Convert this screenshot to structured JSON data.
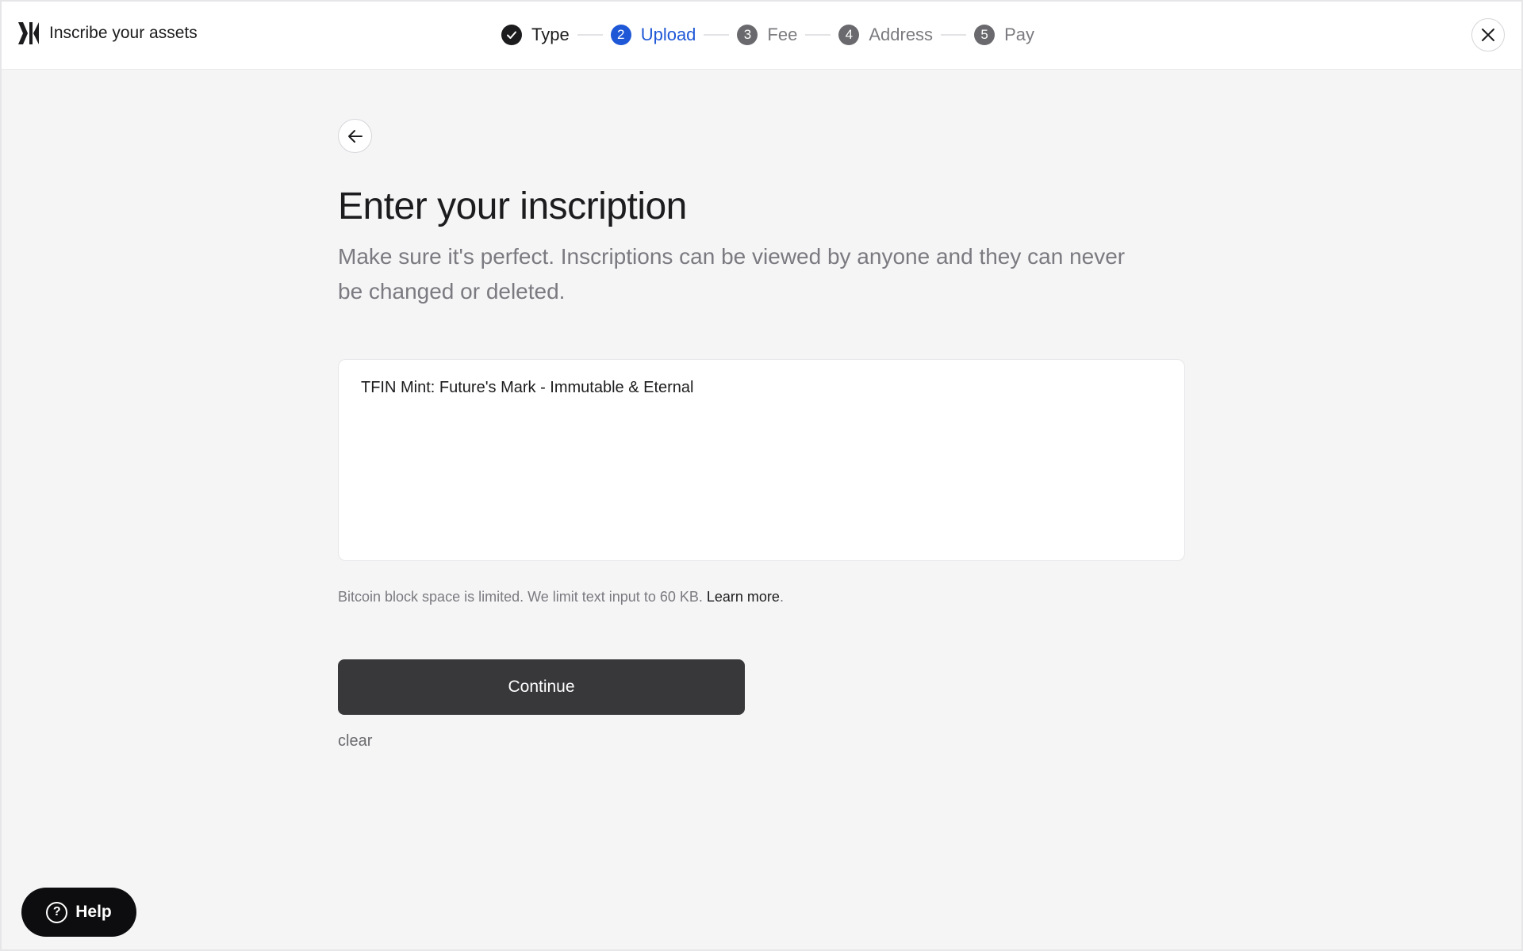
{
  "header": {
    "title": "Inscribe your assets",
    "logo_icon": "brand-logo-icon",
    "close_icon": "close-icon"
  },
  "stepper": {
    "steps": [
      {
        "number": "",
        "label": "Type",
        "state": "done",
        "icon": "check-icon"
      },
      {
        "number": "2",
        "label": "Upload",
        "state": "active"
      },
      {
        "number": "3",
        "label": "Fee",
        "state": "todo"
      },
      {
        "number": "4",
        "label": "Address",
        "state": "todo"
      },
      {
        "number": "5",
        "label": "Pay",
        "state": "todo"
      }
    ]
  },
  "main": {
    "back_icon": "arrow-left-icon",
    "heading": "Enter your inscription",
    "subtitle": "Make sure it's perfect. Inscriptions can be viewed by anyone and they can never be changed or deleted.",
    "inscription_value": "TFIN Mint: Future's Mark - Immutable & Eternal",
    "limit_note": "Bitcoin block space is limited. We limit text input to 60 KB.",
    "learn_more": "Learn more",
    "period": ".",
    "continue_label": "Continue",
    "clear_label": "clear"
  },
  "help": {
    "label": "Help",
    "icon": "question-circle-icon",
    "icon_glyph": "?"
  },
  "colors": {
    "accent": "#1f58d6",
    "button_dark": "#38383b",
    "background": "#f5f5f6"
  }
}
